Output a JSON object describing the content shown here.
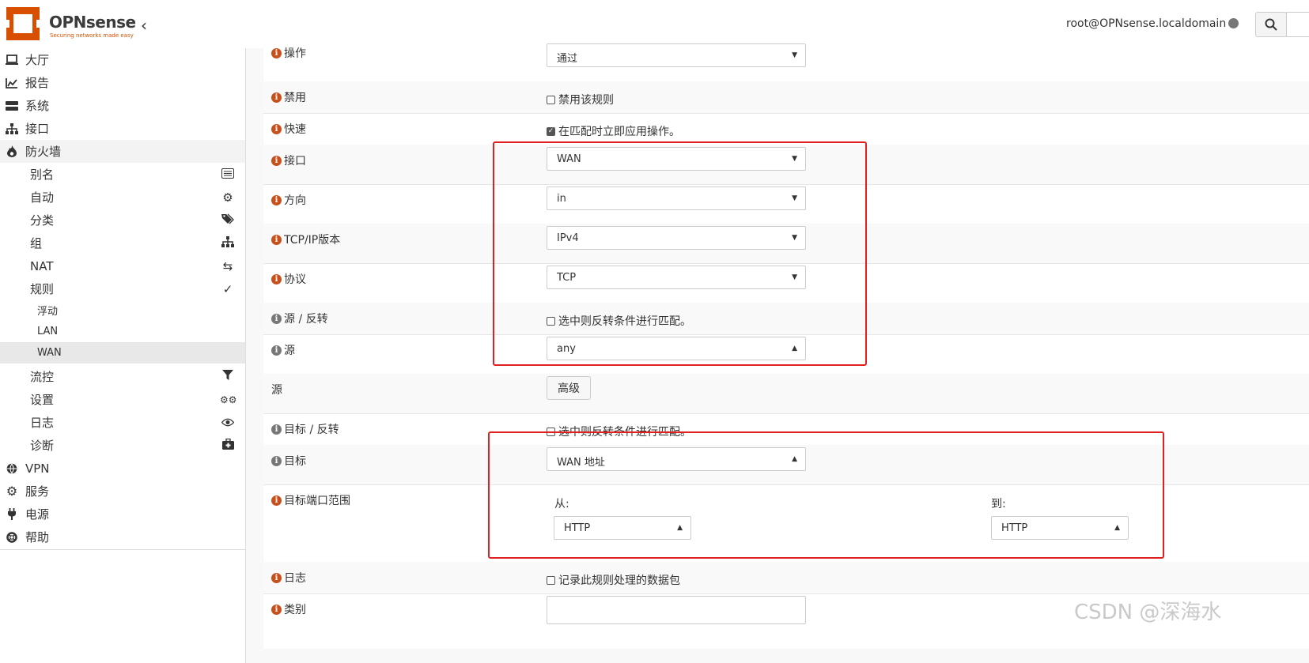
{
  "brand": {
    "name": "OPNsense",
    "tagline": "Securing networks made easy",
    "accent": "#d94f00"
  },
  "header": {
    "user": "root@OPNsense.localdomain"
  },
  "sidebar": {
    "top": [
      {
        "label": "大厅",
        "icon": "laptop-icon"
      },
      {
        "label": "报告",
        "icon": "chart-icon"
      },
      {
        "label": "系统",
        "icon": "server-icon"
      },
      {
        "label": "接口",
        "icon": "sitemap-icon"
      },
      {
        "label": "防火墙",
        "icon": "fire-icon"
      }
    ],
    "firewall": [
      {
        "label": "别名",
        "icon": "list-icon"
      },
      {
        "label": "自动",
        "icon": "gear-icon"
      },
      {
        "label": "分类",
        "icon": "tags-icon"
      },
      {
        "label": "组",
        "icon": "sitemap-icon"
      },
      {
        "label": "NAT",
        "icon": "exchange-icon"
      },
      {
        "label": "规则",
        "icon": "check-icon"
      }
    ],
    "rules": [
      {
        "label": "浮动"
      },
      {
        "label": "LAN"
      },
      {
        "label": "WAN"
      }
    ],
    "firewall_more": [
      {
        "label": "流控",
        "icon": "filter-icon"
      },
      {
        "label": "设置",
        "icon": "cogs-icon"
      },
      {
        "label": "日志",
        "icon": "eye-icon"
      },
      {
        "label": "诊断",
        "icon": "medkit-icon"
      }
    ],
    "bottom": [
      {
        "label": "VPN",
        "icon": "globe-icon"
      },
      {
        "label": "服务",
        "icon": "gear-icon"
      },
      {
        "label": "电源",
        "icon": "plug-icon"
      },
      {
        "label": "帮助",
        "icon": "lifebuoy-icon"
      }
    ]
  },
  "form": {
    "action": {
      "label": "操作",
      "value": "通过"
    },
    "disabled": {
      "label": "禁用",
      "check_label": "禁用该规则"
    },
    "quick": {
      "label": "快速",
      "check_label": "在匹配时立即应用操作。"
    },
    "interface": {
      "label": "接口",
      "value": "WAN"
    },
    "direction": {
      "label": "方向",
      "value": "in"
    },
    "ipversion": {
      "label": "TCP/IP版本",
      "value": "IPv4"
    },
    "protocol": {
      "label": "协议",
      "value": "TCP"
    },
    "source_invert": {
      "label": "源 / 反转",
      "check_label": "选中则反转条件进行匹配。"
    },
    "source": {
      "label": "源",
      "value": "any"
    },
    "source_adv": {
      "label": "源",
      "button": "高级"
    },
    "dest_invert": {
      "label": "目标 / 反转",
      "check_label": "选中则反转条件进行匹配。"
    },
    "dest": {
      "label": "目标",
      "value": "WAN 地址"
    },
    "dest_port": {
      "label": "目标端口范围",
      "from_label": "从:",
      "from_value": "HTTP",
      "to_label": "到:",
      "to_value": "HTTP"
    },
    "log": {
      "label": "日志",
      "check_label": "记录此规则处理的数据包"
    },
    "category": {
      "label": "类别"
    }
  },
  "watermark": "CSDN @深海水"
}
